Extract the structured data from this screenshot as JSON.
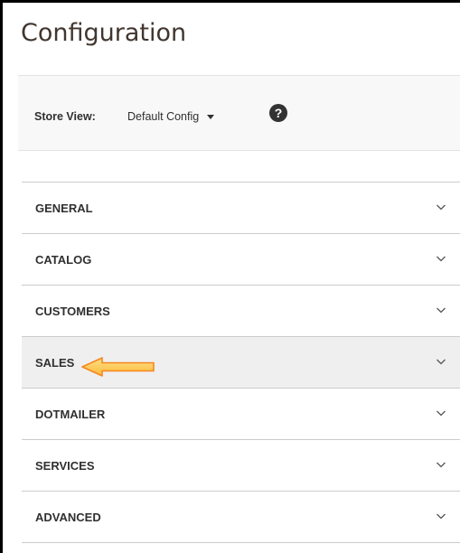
{
  "page": {
    "title": "Configuration"
  },
  "store_bar": {
    "label": "Store View:",
    "current_scope": "Default Config",
    "help_glyph": "?"
  },
  "sections": [
    {
      "label": "GENERAL",
      "icon": "chevron-down-icon"
    },
    {
      "label": "CATALOG",
      "icon": "chevron-down-icon"
    },
    {
      "label": "CUSTOMERS",
      "icon": "chevron-down-icon"
    },
    {
      "label": "SALES",
      "icon": "chevron-down-icon",
      "highlighted": true
    },
    {
      "label": "DOTMAILER",
      "icon": "chevron-down-icon"
    },
    {
      "label": "SERVICES",
      "icon": "chevron-down-icon"
    },
    {
      "label": "ADVANCED",
      "icon": "chevron-down-icon"
    }
  ],
  "colors": {
    "annotation_arrow_fill": "#fcb937",
    "annotation_arrow_stroke": "#f5871f",
    "active_row": "#efefef",
    "title_text": "#41362f"
  }
}
